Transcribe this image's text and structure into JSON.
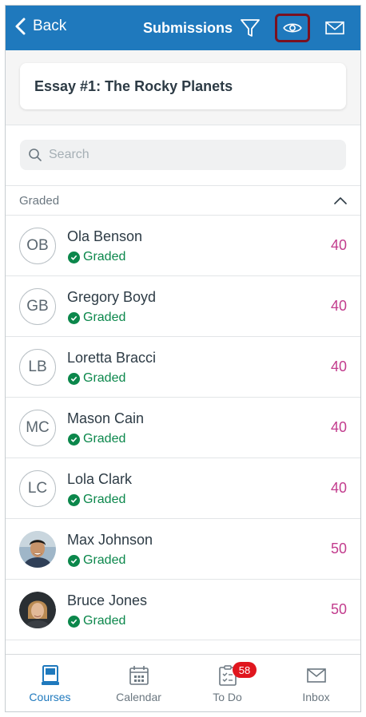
{
  "header": {
    "back_label": "Back",
    "title": "Submissions",
    "bg_color": "#1f79bd",
    "highlight_color": "#7a1120"
  },
  "assignment": {
    "title": "Essay #1: The Rocky Planets"
  },
  "search": {
    "placeholder": "Search",
    "value": ""
  },
  "section": {
    "label": "Graded"
  },
  "students": [
    {
      "initials": "OB",
      "name": "Ola Benson",
      "status": "Graded",
      "score": "40"
    },
    {
      "initials": "GB",
      "name": "Gregory Boyd",
      "status": "Graded",
      "score": "40"
    },
    {
      "initials": "LB",
      "name": "Loretta Bracci",
      "status": "Graded",
      "score": "40"
    },
    {
      "initials": "MC",
      "name": "Mason Cain",
      "status": "Graded",
      "score": "40"
    },
    {
      "initials": "LC",
      "name": "Lola Clark",
      "status": "Graded",
      "score": "40"
    },
    {
      "initials": "",
      "name": "Max Johnson",
      "status": "Graded",
      "score": "50"
    },
    {
      "initials": "",
      "name": "Bruce Jones",
      "status": "Graded",
      "score": "50"
    }
  ],
  "tabs": [
    {
      "label": "Courses",
      "icon": "courses-icon",
      "active": true
    },
    {
      "label": "Calendar",
      "icon": "calendar-icon",
      "active": false
    },
    {
      "label": "To Do",
      "icon": "todo-icon",
      "active": false,
      "badge": "58"
    },
    {
      "label": "Inbox",
      "icon": "inbox-icon",
      "active": false
    }
  ],
  "colors": {
    "score": "#c23c8d",
    "graded": "#0b874b",
    "accent": "#1f79bd",
    "badge": "#e0161e"
  }
}
